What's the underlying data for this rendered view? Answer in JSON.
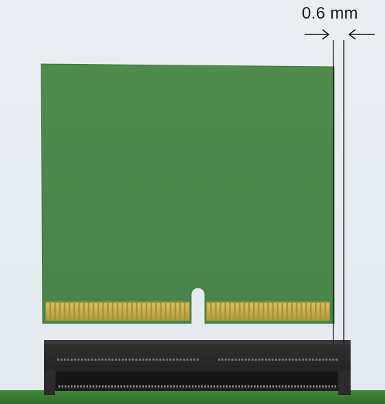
{
  "dimension": {
    "label": "0.6 mm"
  },
  "icons": {
    "left_arrow": "right-pointing-arrow-icon",
    "right_arrow": "left-pointing-arrow-icon"
  },
  "colors": {
    "module_pcb": "#4d8a4a",
    "module_pcb_edge": "#3f7a3d",
    "gold_finger": "#c8b24f",
    "connector_body": "#262626",
    "host_board": "#3c7d35",
    "background": "#e6ebf0"
  },
  "module": {
    "contacts_left_count": 30,
    "contacts_right_count": 26
  }
}
